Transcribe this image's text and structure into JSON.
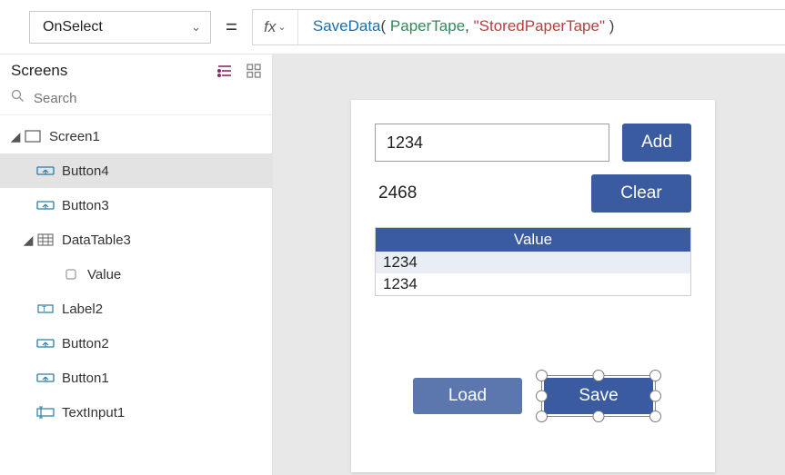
{
  "property_dropdown": {
    "selected": "OnSelect"
  },
  "formula": {
    "tokens": [
      {
        "t": "SaveData",
        "c": "t-func"
      },
      {
        "t": "( ",
        "c": "t-punct"
      },
      {
        "t": "PaperTape",
        "c": "t-ident"
      },
      {
        "t": ", ",
        "c": "t-punct"
      },
      {
        "t": "\"StoredPaperTape\"",
        "c": "t-str"
      },
      {
        "t": " )",
        "c": "t-punct"
      }
    ]
  },
  "tree": {
    "title": "Screens",
    "search_placeholder": "Search",
    "nodes": {
      "screen1": "Screen1",
      "button4": "Button4",
      "button3": "Button3",
      "datatable3": "DataTable3",
      "value": "Value",
      "label2": "Label2",
      "button2": "Button2",
      "button1": "Button1",
      "textinput1": "TextInput1"
    }
  },
  "canvas": {
    "textinput_value": "1234",
    "label_value": "2468",
    "buttons": {
      "add": "Add",
      "clear": "Clear",
      "load": "Load",
      "save": "Save"
    },
    "table": {
      "header": "Value",
      "rows": [
        "1234",
        "1234"
      ]
    }
  }
}
